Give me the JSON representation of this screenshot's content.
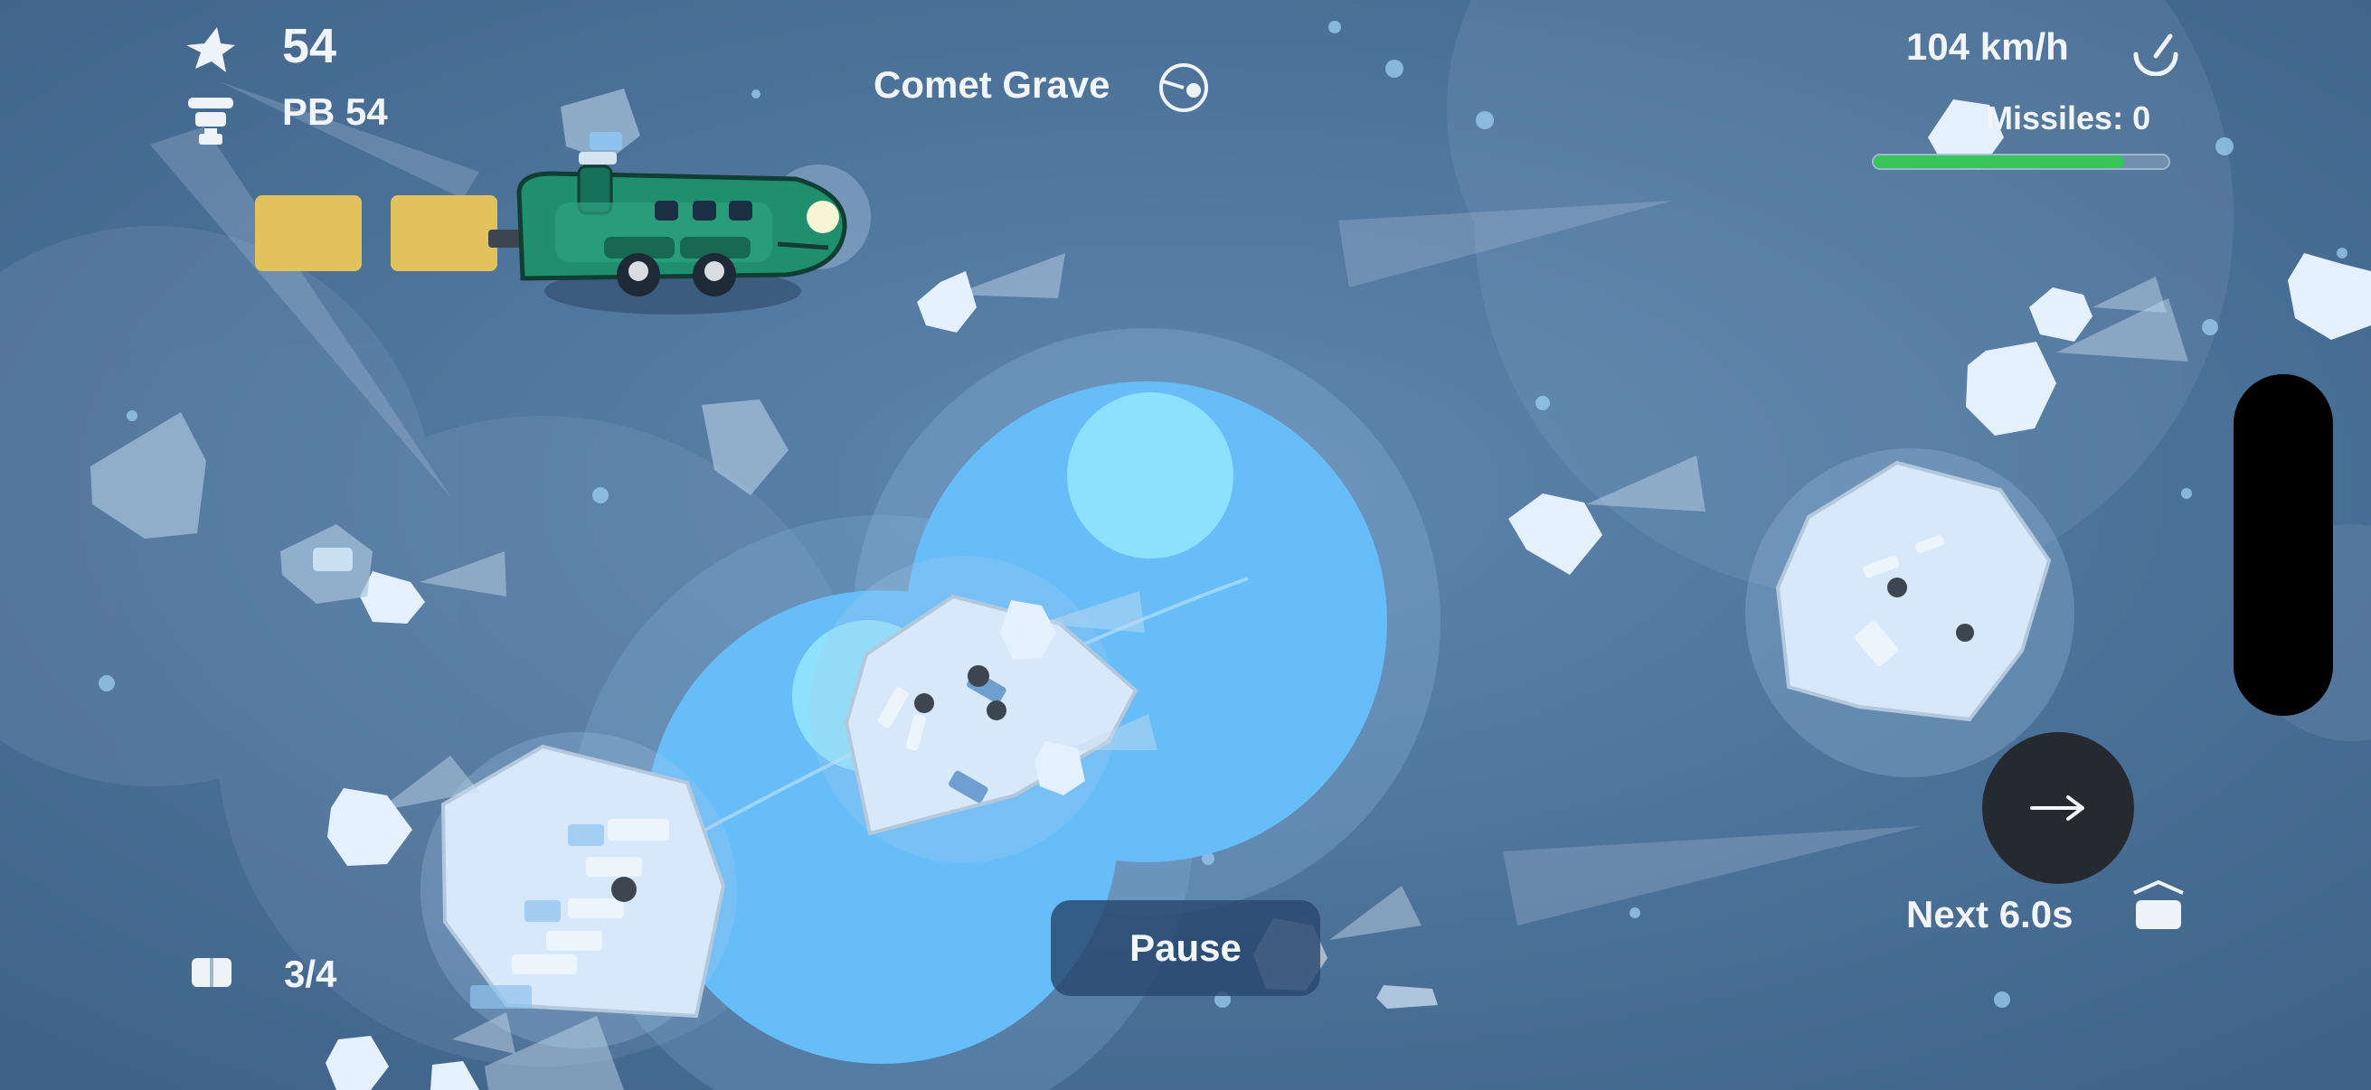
{
  "hud": {
    "score": "54",
    "personal_best": "PB 54",
    "level_name": "Comet Grave",
    "speed": "104 km/h",
    "missiles": "Missiles: 0",
    "missile_charge": 0.85,
    "cars": "3/4",
    "next_timer": "Next 6.0s",
    "pause_label": "Pause",
    "next_button_glyph": "→"
  },
  "icons": {
    "score": "star-icon",
    "personal_best": "trophy-icon",
    "level": "gauge-icon",
    "speed": "speedometer-icon",
    "cars": "train-car-icon",
    "next": "crate-icon"
  },
  "colors": {
    "background": "#4a6e93",
    "train_body": "#1f8f6e",
    "train_cars": "#e1c25c",
    "missile_bar": "#37c55a",
    "planet": "#6ac0f8",
    "asteroid": "#d4e6f7"
  }
}
